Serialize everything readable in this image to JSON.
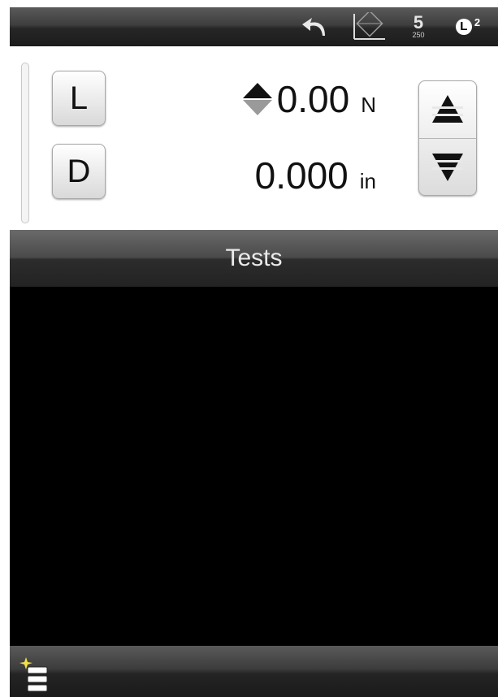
{
  "statusbar": {
    "undo_icon": "undo-arrow-icon",
    "plot_icon": "plot-view-icon",
    "sample": {
      "value": "5",
      "sub": "250"
    },
    "level": {
      "letter": "L",
      "superscript": "2"
    }
  },
  "readout": {
    "load": {
      "key_label": "L",
      "value": "0.00",
      "unit": "N",
      "direction_icon": "up-down-direction-icon"
    },
    "displacement": {
      "key_label": "D",
      "value": "0.000",
      "unit": "in"
    },
    "jog_up_icon": "jog-up-icon",
    "jog_down_icon": "jog-down-icon"
  },
  "tests": {
    "title": "Tests"
  },
  "bottombar": {
    "menu_icon": "new-test-menu-icon"
  },
  "colors": {
    "bar_dark": "#2a2a2a",
    "panel_bg": "#ffffff",
    "screen_bg": "#000000",
    "sparkle": "#f2e14a"
  }
}
